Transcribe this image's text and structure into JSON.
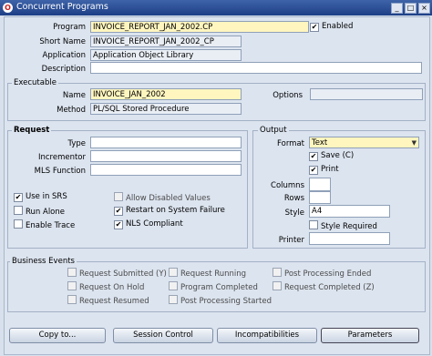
{
  "window": {
    "title": "Concurrent Programs",
    "min": "_",
    "max": "□",
    "close": "×"
  },
  "program": {
    "program_label": "Program",
    "program_value": "INVOICE_REPORT_JAN_2002.CP",
    "enabled_label": "Enabled",
    "enabled_checked": true,
    "short_name_label": "Short Name",
    "short_name_value": "INVOICE_REPORT_JAN_2002_CP",
    "application_label": "Application",
    "application_value": "Application Object Library",
    "description_label": "Description",
    "description_value": ""
  },
  "executable": {
    "title": "Executable",
    "name_label": "Name",
    "name_value": "INVOICE_JAN_2002",
    "options_label": "Options",
    "options_value": "",
    "method_label": "Method",
    "method_value": "PL/SQL Stored Procedure"
  },
  "request": {
    "title": "Request",
    "type_label": "Type",
    "type_value": "",
    "incrementor_label": "Incrementor",
    "incrementor_value": "",
    "mls_label": "MLS Function",
    "mls_value": "",
    "checkboxes": [
      {
        "label": "Use in SRS",
        "checked": true,
        "enabled": true
      },
      {
        "label": "Allow Disabled Values",
        "checked": false,
        "enabled": false
      },
      {
        "label": "Run Alone",
        "checked": false,
        "enabled": true
      },
      {
        "label": "Restart on System Failure",
        "checked": true,
        "enabled": true
      },
      {
        "label": "Enable Trace",
        "checked": false,
        "enabled": true
      },
      {
        "label": "NLS Compliant",
        "checked": true,
        "enabled": true
      }
    ]
  },
  "output": {
    "title": "Output",
    "format_label": "Format",
    "format_value": "Text",
    "save_label": "Save (C)",
    "save_checked": true,
    "print_label": "Print",
    "print_checked": true,
    "columns_label": "Columns",
    "columns_value": "",
    "rows_label": "Rows",
    "rows_value": "",
    "style_label": "Style",
    "style_value": "A4",
    "style_required_label": "Style Required",
    "style_required_checked": false,
    "printer_label": "Printer",
    "printer_value": ""
  },
  "business_events": {
    "title": "Business Events",
    "items": [
      {
        "label": "Request Submitted (Y)"
      },
      {
        "label": "Request Running"
      },
      {
        "label": "Post Processing Ended"
      },
      {
        "label": "Request On Hold"
      },
      {
        "label": "Program Completed"
      },
      {
        "label": "Request Completed (Z)"
      },
      {
        "label": "Request Resumed"
      },
      {
        "label": "Post Processing Started"
      }
    ]
  },
  "buttons": {
    "copy": "Copy to...",
    "session": "Session Control",
    "incompat": "Incompatibilities",
    "params": "Parameters"
  },
  "colors": {
    "required": "#fff6bf",
    "background": "#dce4ef",
    "titlebar": "#2b4f96"
  }
}
